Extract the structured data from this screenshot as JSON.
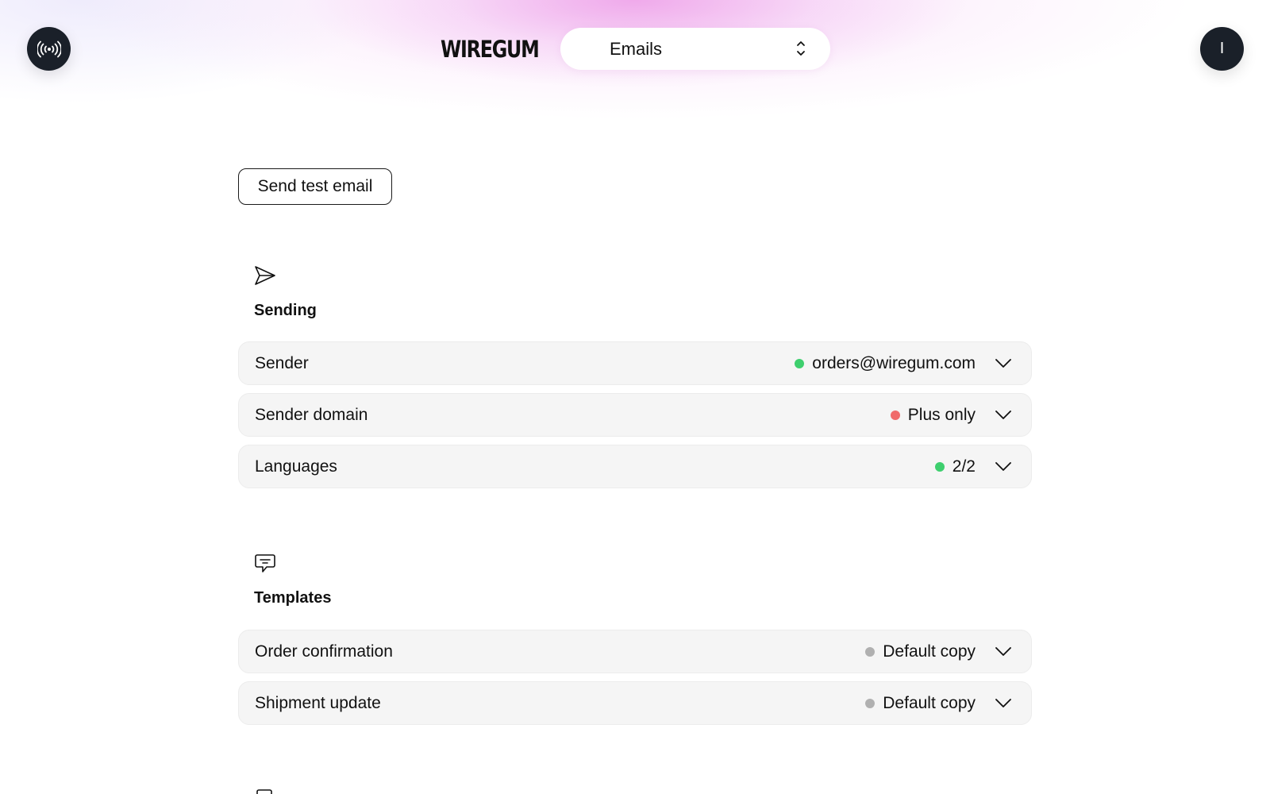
{
  "header": {
    "logo": "WIREGUM",
    "selector": {
      "value": "Emails",
      "icon": "up-down-chevron-icon"
    },
    "left_button_icon": "broadcast-icon",
    "avatar_initial": "I"
  },
  "actions": {
    "send_test_label": "Send test email"
  },
  "sections": {
    "sending": {
      "icon": "send-icon",
      "title": "Sending",
      "rows": [
        {
          "label": "Sender",
          "status": "orders@wiregum.com",
          "status_color": "#3ecf6e"
        },
        {
          "label": "Sender domain",
          "status": "Plus only",
          "status_color": "#f06b6b"
        },
        {
          "label": "Languages",
          "status": "2/2",
          "status_color": "#3ecf6e"
        }
      ]
    },
    "templates": {
      "icon": "message-icon",
      "title": "Templates",
      "rows": [
        {
          "label": "Order confirmation",
          "status": "Default copy",
          "status_color": "#b0b0b0"
        },
        {
          "label": "Shipment update",
          "status": "Default copy",
          "status_color": "#b0b0b0"
        }
      ]
    }
  },
  "colors": {
    "dark": "#1a2029",
    "row_bg": "#f5f5f5",
    "accent_glow": "#ec96e6"
  }
}
